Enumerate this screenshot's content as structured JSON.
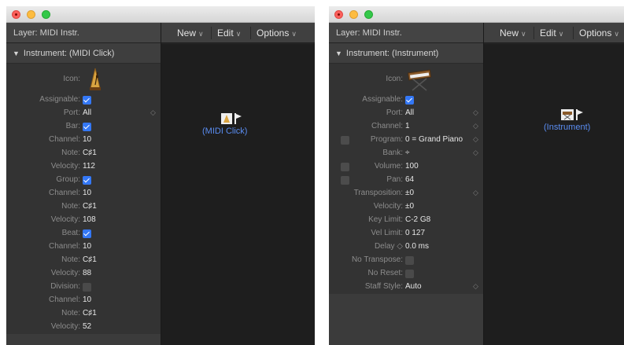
{
  "left_window": {
    "layer_label": "Layer: MIDI Instr.",
    "inspector_title": "Instrument:  (MIDI Click)",
    "menus": [
      "New",
      "Edit",
      "Options"
    ],
    "object_label": "(MIDI Click)",
    "params": [
      {
        "label": "Assignable:",
        "check": true
      },
      {
        "label": "Port:",
        "value": "All",
        "stepper": true
      },
      {
        "label": "Bar:",
        "check": true
      },
      {
        "label": "Channel:",
        "value": "10"
      },
      {
        "label": "Note:",
        "value": "C♯1"
      },
      {
        "label": "Velocity:",
        "value": "112"
      },
      {
        "label": "Group:",
        "check": true
      },
      {
        "label": "Channel:",
        "value": "10"
      },
      {
        "label": "Note:",
        "value": "C♯1"
      },
      {
        "label": "Velocity:",
        "value": "108"
      },
      {
        "label": "Beat:",
        "check": true
      },
      {
        "label": "Channel:",
        "value": "10"
      },
      {
        "label": "Note:",
        "value": "C♯1"
      },
      {
        "label": "Velocity:",
        "value": "88"
      },
      {
        "label": "Division:",
        "check": false
      },
      {
        "label": "Channel:",
        "value": "10"
      },
      {
        "label": "Note:",
        "value": "C♯1"
      },
      {
        "label": "Velocity:",
        "value": "52"
      }
    ]
  },
  "right_window": {
    "layer_label": "Layer: MIDI Instr.",
    "inspector_title": "Instrument:  (Instrument)",
    "menus": [
      "New",
      "Edit",
      "Options"
    ],
    "object_label": "(Instrument)",
    "params": [
      {
        "label": "Assignable:",
        "check": true
      },
      {
        "label": "Port:",
        "value": "All",
        "stepper": true
      },
      {
        "label": "Channel:",
        "value": "1",
        "stepper": true
      },
      {
        "label": "Program:",
        "value": "0 = Grand Piano",
        "stepper": true,
        "left_check": true
      },
      {
        "label": "Bank:",
        "value": "÷",
        "stepper": true
      },
      {
        "label": "Volume:",
        "value": "100",
        "left_check": true
      },
      {
        "label": "Pan:",
        "value": "64",
        "left_check": true
      },
      {
        "label": "Transposition:",
        "value": "±0",
        "stepper": true
      },
      {
        "label": "Velocity:",
        "value": "±0"
      },
      {
        "label": "Key Limit:",
        "value": "C-2    G8"
      },
      {
        "label": "Vel Limit:",
        "value": "0    127"
      },
      {
        "label": "Delay ◇",
        "value": "0.0 ms"
      },
      {
        "label": "No Transpose:",
        "check": false
      },
      {
        "label": "No Reset:",
        "check": false
      },
      {
        "label": "Staff Style:",
        "value": "Auto",
        "stepper": true
      }
    ]
  },
  "icon_label": "Icon:",
  "stepper_glyph": "◇",
  "colors": {
    "checkbox_on": "#3478f6",
    "object_label": "#5a8df2"
  }
}
